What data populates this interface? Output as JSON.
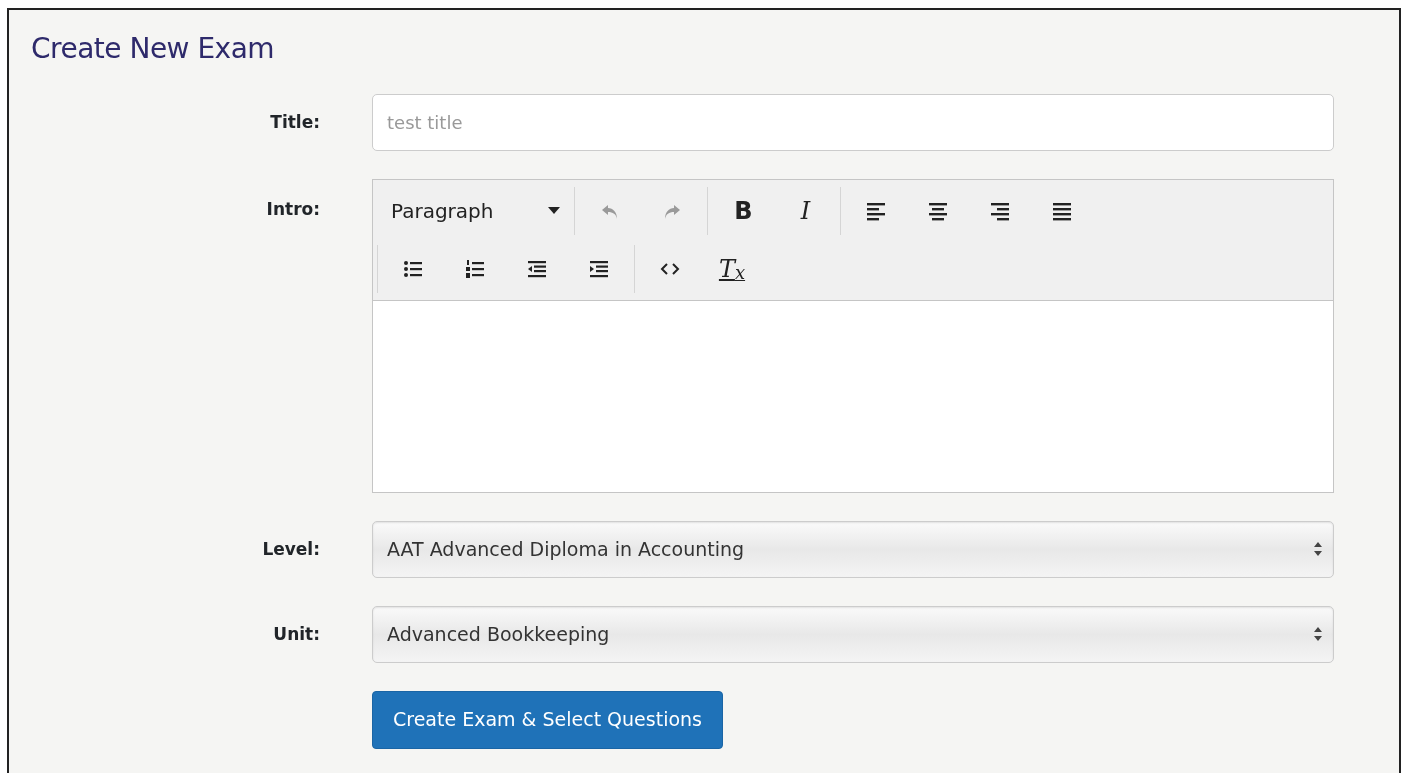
{
  "heading": "Create New Exam",
  "fields": [
    {
      "kind": "text",
      "label": "Title:",
      "placeholder": "test title"
    },
    {
      "kind": "editor",
      "label": "Intro:",
      "toolbar_rows": [
        [
          [
            {
              "kind": "format-dropdown",
              "label": "Paragraph"
            }
          ],
          [
            {
              "kind": "undo",
              "disabled": true
            },
            {
              "kind": "redo",
              "disabled": true
            }
          ],
          [
            {
              "kind": "bold",
              "glyph": "B",
              "disabled": false
            },
            {
              "kind": "italic",
              "glyph": "I",
              "disabled": false
            }
          ],
          [
            {
              "kind": "align-left",
              "disabled": false
            },
            {
              "kind": "align-center",
              "disabled": false
            },
            {
              "kind": "align-right",
              "disabled": false
            },
            {
              "kind": "justify",
              "disabled": false
            }
          ]
        ],
        [
          [
            {
              "kind": "bullet-list",
              "disabled": false
            },
            {
              "kind": "numbered-list",
              "disabled": false
            },
            {
              "kind": "outdent",
              "disabled": false
            },
            {
              "kind": "indent",
              "disabled": false
            }
          ],
          [
            {
              "kind": "code",
              "disabled": false
            },
            {
              "kind": "clear-format",
              "glyph": "T$_{x}$",
              "disabled": false
            }
          ]
        ]
      ]
    },
    {
      "kind": "select",
      "label": "Level:",
      "value": "AAT Advanced Diploma in Accounting"
    },
    {
      "kind": "select",
      "label": "Unit:",
      "value": "Advanced Bookkeeping"
    }
  ],
  "submit": "Create Exam & Select Questions"
}
